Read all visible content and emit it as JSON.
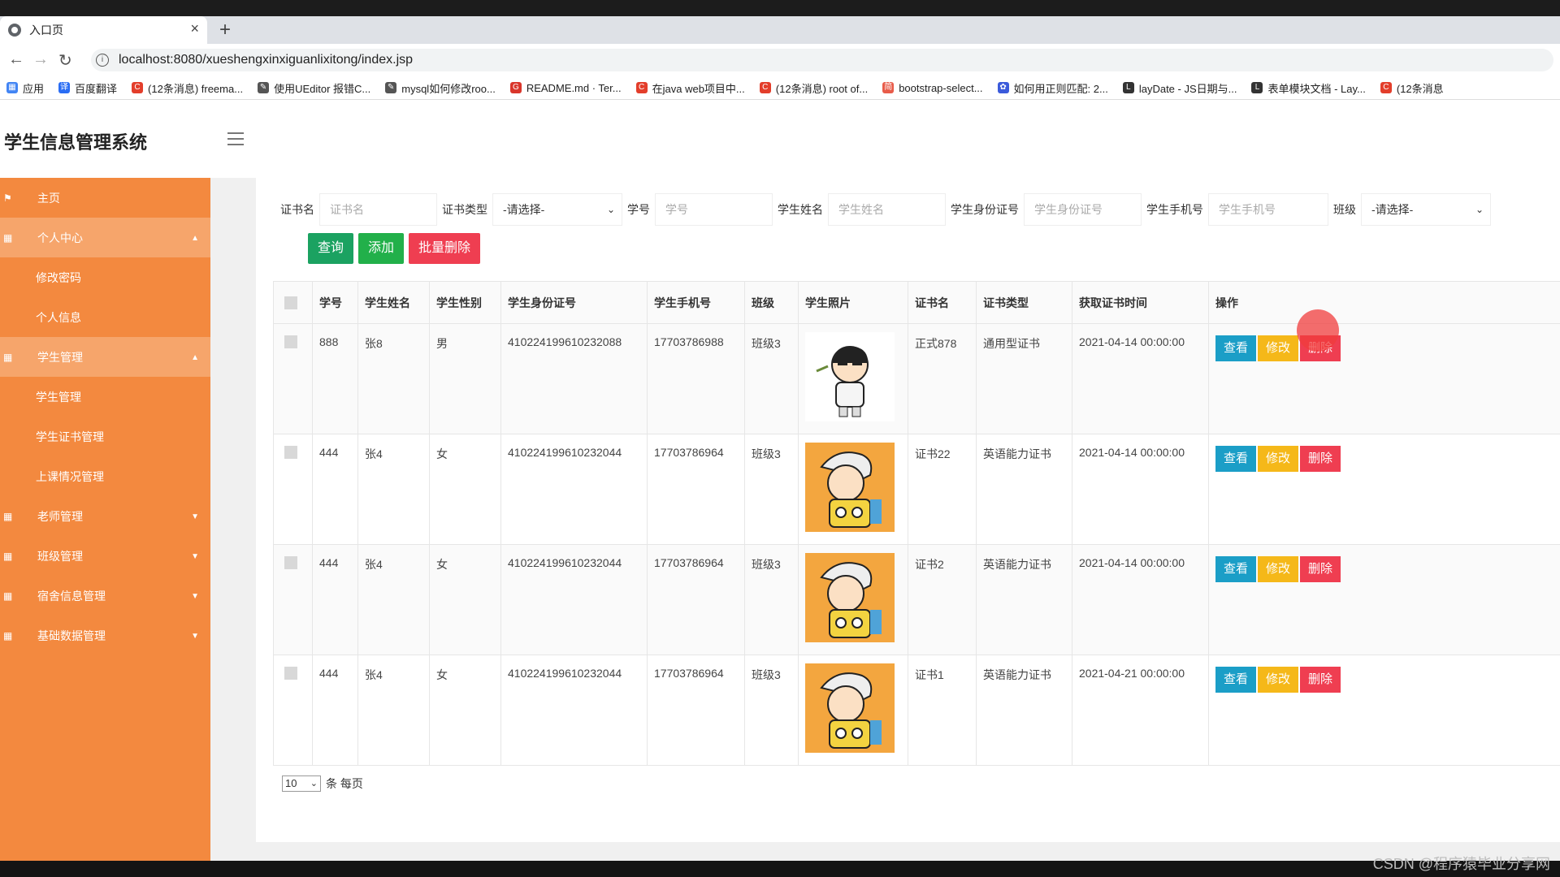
{
  "browser": {
    "tab_title": "入口页",
    "new_tab": "+",
    "url": "localhost:8080/xueshengxinxiguanlixitong/index.jsp",
    "bookmarks": [
      {
        "label": "应用",
        "color": "#4285f4",
        "glyph": "▦"
      },
      {
        "label": "百度翻译",
        "color": "#2a6df4",
        "glyph": "译"
      },
      {
        "label": "(12条消息) freema...",
        "color": "#e33e2b",
        "glyph": "C"
      },
      {
        "label": "使用UEditor 报错C...",
        "color": "#555555",
        "glyph": "✎"
      },
      {
        "label": "mysql如何修改roo...",
        "color": "#555555",
        "glyph": "✎"
      },
      {
        "label": "README.md · Ter...",
        "color": "#d9362b",
        "glyph": "G"
      },
      {
        "label": "在java web项目中...",
        "color": "#e33e2b",
        "glyph": "C"
      },
      {
        "label": "(12条消息) root of...",
        "color": "#e33e2b",
        "glyph": "C"
      },
      {
        "label": "bootstrap-select...",
        "color": "#e85c4a",
        "glyph": "简"
      },
      {
        "label": "如何用正则匹配: 2...",
        "color": "#3b5bdb",
        "glyph": "✿"
      },
      {
        "label": "layDate - JS日期与...",
        "color": "#333333",
        "glyph": "L"
      },
      {
        "label": "表单模块文档 - Lay...",
        "color": "#333333",
        "glyph": "L"
      },
      {
        "label": "(12条消息",
        "color": "#e33e2b",
        "glyph": "C"
      }
    ]
  },
  "app": {
    "title": "学生信息管理系统"
  },
  "sidebar": {
    "items": [
      {
        "label": "主页",
        "icon": "flag-icon",
        "type": "item"
      },
      {
        "label": "个人中心",
        "icon": "grid-icon",
        "type": "group",
        "caret": "▲",
        "active": true
      },
      {
        "label": "修改密码",
        "type": "sub"
      },
      {
        "label": "个人信息",
        "type": "sub"
      },
      {
        "label": "学生管理",
        "icon": "grid-icon",
        "type": "group",
        "caret": "▲",
        "active": true
      },
      {
        "label": "学生管理",
        "type": "sub"
      },
      {
        "label": "学生证书管理",
        "type": "sub"
      },
      {
        "label": "上课情况管理",
        "type": "sub"
      },
      {
        "label": "老师管理",
        "icon": "grid-icon",
        "type": "group",
        "caret": "▼"
      },
      {
        "label": "班级管理",
        "icon": "grid-icon",
        "type": "group",
        "caret": "▼"
      },
      {
        "label": "宿舍信息管理",
        "icon": "grid-icon",
        "type": "group",
        "caret": "▼"
      },
      {
        "label": "基础数据管理",
        "icon": "grid-icon",
        "type": "group",
        "caret": "▼"
      }
    ]
  },
  "filters": {
    "cert_name_label": "证书名",
    "cert_name_placeholder": "证书名",
    "cert_type_label": "证书类型",
    "cert_type_value": "-请选择-",
    "student_no_label": "学号",
    "student_no_placeholder": "学号",
    "student_name_label": "学生姓名",
    "student_name_placeholder": "学生姓名",
    "id_card_label": "学生身份证号",
    "id_card_placeholder": "学生身份证号",
    "phone_label": "学生手机号",
    "phone_placeholder": "学生手机号",
    "class_label": "班级",
    "class_value": "-请选择-"
  },
  "actions": {
    "query": "查询",
    "add": "添加",
    "batch_delete": "批量删除"
  },
  "table": {
    "headers": [
      "学号",
      "学生姓名",
      "学生性别",
      "学生身份证号",
      "学生手机号",
      "班级",
      "学生照片",
      "证书名",
      "证书类型",
      "获取证书时间",
      "操作"
    ],
    "rows": [
      {
        "no": "888",
        "name": "张8",
        "gender": "男",
        "id_card": "410224199610232088",
        "phone": "17703786988",
        "class": "班级3",
        "photo": "white",
        "cert": "正式878",
        "cert_type": "通用型证书",
        "time": "2021-04-14 00:00:00"
      },
      {
        "no": "444",
        "name": "张4",
        "gender": "女",
        "id_card": "410224199610232044",
        "phone": "17703786964",
        "class": "班级3",
        "photo": "orange",
        "cert": "证书22",
        "cert_type": "英语能力证书",
        "time": "2021-04-14 00:00:00"
      },
      {
        "no": "444",
        "name": "张4",
        "gender": "女",
        "id_card": "410224199610232044",
        "phone": "17703786964",
        "class": "班级3",
        "photo": "orange",
        "cert": "证书2",
        "cert_type": "英语能力证书",
        "time": "2021-04-14 00:00:00"
      },
      {
        "no": "444",
        "name": "张4",
        "gender": "女",
        "id_card": "410224199610232044",
        "phone": "17703786964",
        "class": "班级3",
        "photo": "orange",
        "cert": "证书1",
        "cert_type": "英语能力证书",
        "time": "2021-04-21 00:00:00"
      }
    ],
    "op_view": "查看",
    "op_edit": "修改",
    "op_delete": "删除"
  },
  "pager": {
    "page_size": "10",
    "suffix": "条 每页"
  },
  "watermark": "CSDN @程序猿毕业分享网"
}
